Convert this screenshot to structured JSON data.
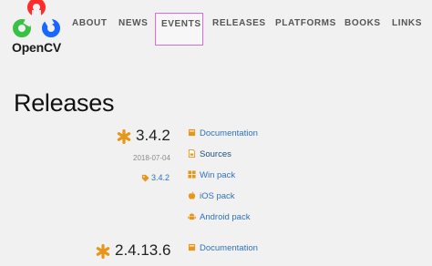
{
  "logo": {
    "text": "OpenCV"
  },
  "nav": {
    "items": [
      {
        "label": "ABOUT"
      },
      {
        "label": "NEWS"
      },
      {
        "label": "EVENTS"
      },
      {
        "label": "RELEASES"
      },
      {
        "label": "PLATFORMS"
      },
      {
        "label": "BOOKS"
      },
      {
        "label": "LINKS"
      }
    ],
    "active": "EVENTS"
  },
  "page": {
    "title": "Releases"
  },
  "releases": [
    {
      "version": "3.4.2",
      "date": "2018-07-04",
      "tag": "3.4.2",
      "links": [
        {
          "label": "Documentation",
          "icon": "book-icon"
        },
        {
          "label": "Sources",
          "icon": "source-file-icon"
        },
        {
          "label": "Win pack",
          "icon": "windows-icon"
        },
        {
          "label": "iOS pack",
          "icon": "apple-icon"
        },
        {
          "label": "Android pack",
          "icon": "android-icon"
        }
      ]
    },
    {
      "version": "2.4.13.6",
      "links": [
        {
          "label": "Documentation",
          "icon": "book-icon"
        }
      ]
    }
  ],
  "colors": {
    "background": "#f1f1f1",
    "link": "#2f72b8",
    "star": "#e8961a",
    "nav_active_border": "#d86cd8",
    "logo_red": "#ff2a2a",
    "logo_green": "#38c144",
    "logo_blue": "#1a66ff"
  }
}
